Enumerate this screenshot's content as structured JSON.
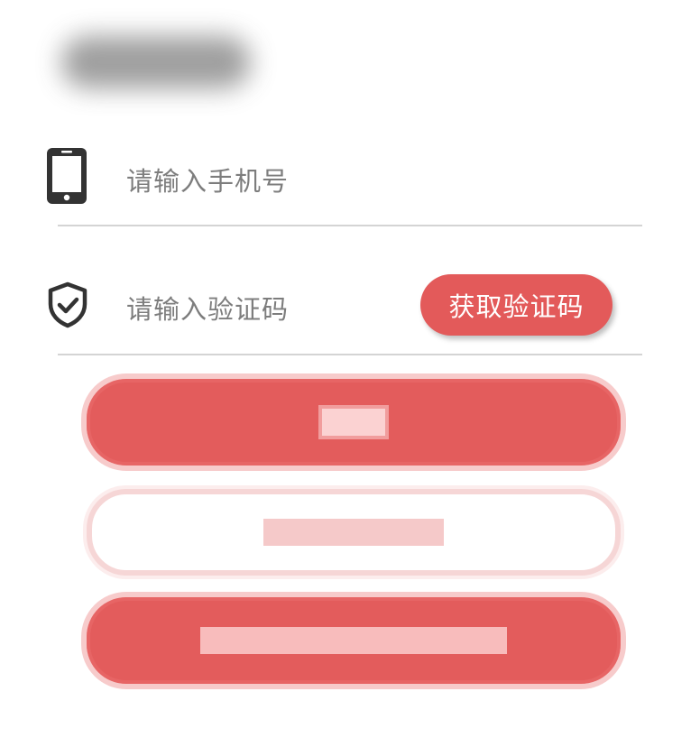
{
  "phone": {
    "placeholder": "请输入手机号",
    "icon": "phone-icon"
  },
  "code": {
    "placeholder": "请输入验证码",
    "icon": "shield-check-icon",
    "get_code_label": "获取验证码"
  },
  "colors": {
    "accent": "#e35a5a",
    "placeholder_text": "#7d7d7d",
    "divider": "#d4d4d4",
    "icon": "#333333"
  }
}
